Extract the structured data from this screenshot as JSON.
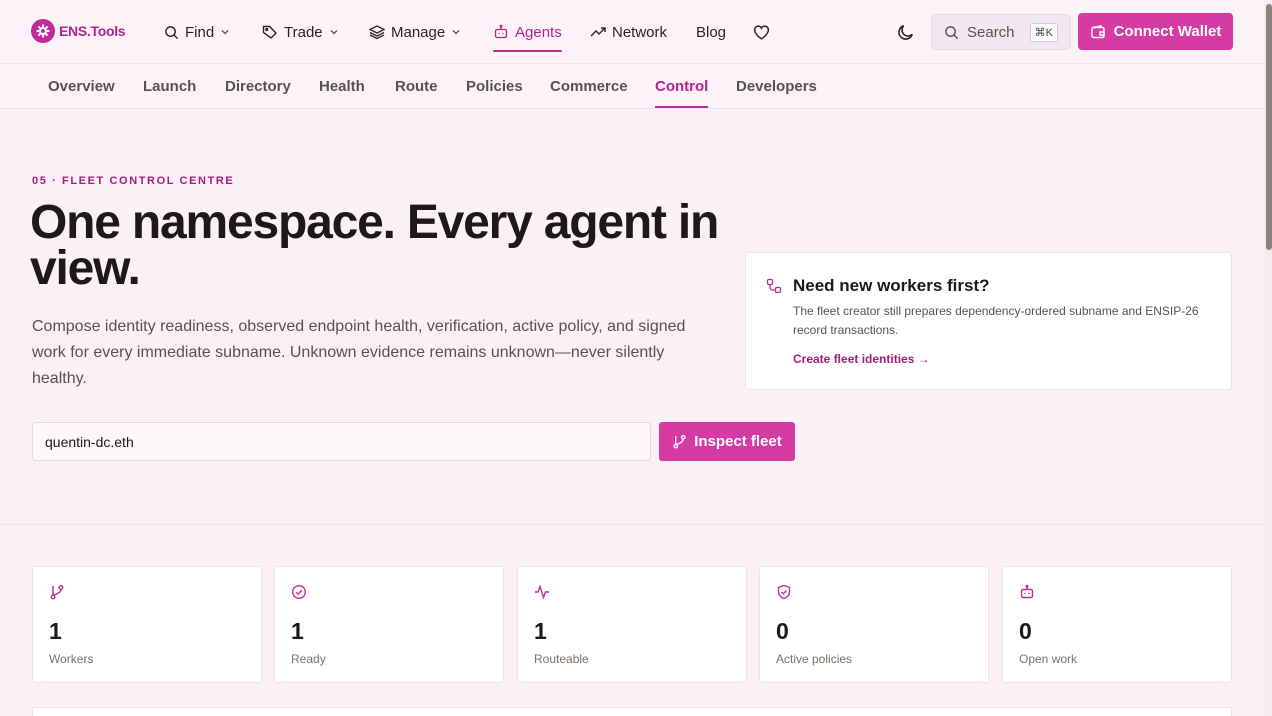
{
  "brand": {
    "name": "ENS.Tools",
    "accent": "#d63aa3",
    "accent_text": "#b4238e"
  },
  "topnav": {
    "items": [
      {
        "label": "Find",
        "icon": "search-icon",
        "dropdown": true
      },
      {
        "label": "Trade",
        "icon": "tag-icon",
        "dropdown": true
      },
      {
        "label": "Manage",
        "icon": "layers-icon",
        "dropdown": true
      },
      {
        "label": "Agents",
        "icon": "bot-icon",
        "active": true
      },
      {
        "label": "Network",
        "icon": "trending-up-icon"
      },
      {
        "label": "Blog"
      }
    ],
    "search": {
      "label": "Search",
      "shortcut": "⌘K"
    },
    "connect_label": "Connect Wallet"
  },
  "subnav": {
    "items": [
      "Overview",
      "Launch",
      "Directory",
      "Health",
      "Route",
      "Policies",
      "Commerce",
      "Control",
      "Developers"
    ],
    "active": "Control"
  },
  "hero": {
    "eyebrow": "05 · FLEET CONTROL CENTRE",
    "headline": "One namespace. Every agent in view.",
    "lede": "Compose identity readiness, observed endpoint health, verification, active policy, and signed work for every immediate subname. Unknown evidence remains unknown—never silently healthy."
  },
  "infocard": {
    "title": "Need new workers first?",
    "body": "The fleet creator still prepares dependency-ordered subname and ENSIP-26 record transactions.",
    "link": "Create fleet identities →"
  },
  "fleet_form": {
    "value": "quentin-dc.eth",
    "button": "Inspect fleet"
  },
  "stats": [
    {
      "value": "1",
      "label": "Workers",
      "icon": "git-branch-icon"
    },
    {
      "value": "1",
      "label": "Ready",
      "icon": "check-circle-icon"
    },
    {
      "value": "1",
      "label": "Routeable",
      "icon": "activity-icon"
    },
    {
      "value": "0",
      "label": "Active policies",
      "icon": "shield-check-icon"
    },
    {
      "value": "0",
      "label": "Open work",
      "icon": "bot-icon"
    }
  ]
}
